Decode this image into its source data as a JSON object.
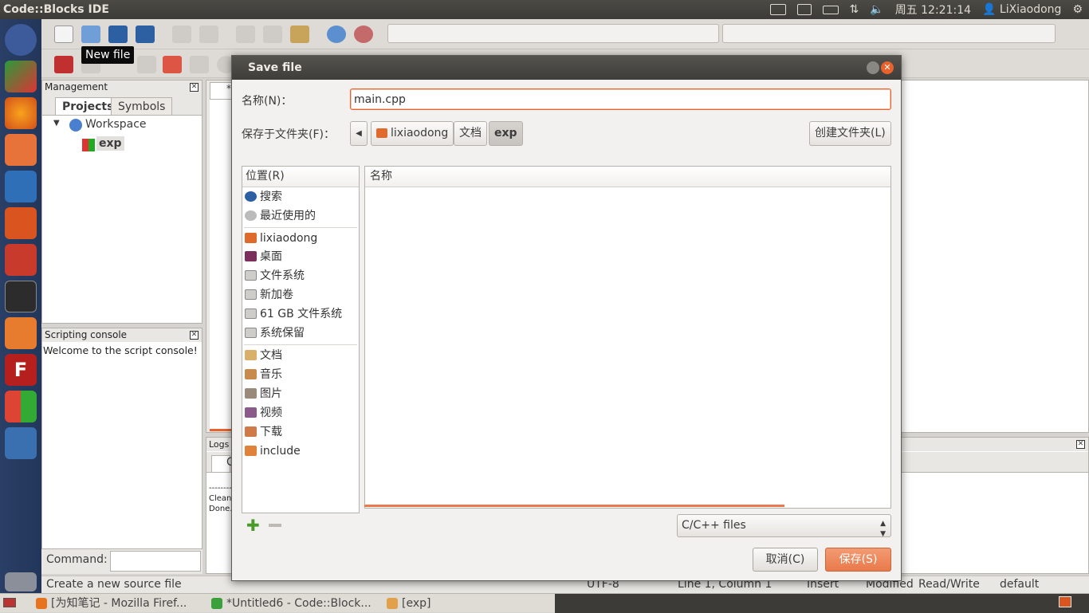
{
  "window": {
    "title": "Code::Blocks IDE"
  },
  "tray": {
    "clock": "周五 12:21:14",
    "user": "LiXiaodong"
  },
  "tooltip": "New file",
  "management": {
    "title": "Management",
    "tabs": [
      "Projects",
      "Symbols"
    ],
    "tree": {
      "root": "Workspace",
      "child": "exp"
    }
  },
  "scripting": {
    "title": "Scripting console",
    "welcome": "Welcome to the script console!",
    "command_label": "Command:"
  },
  "logs": {
    "title": "Logs",
    "tab_partial": "C",
    "lines": [
      "--------",
      "Clean",
      "Done."
    ]
  },
  "dialog": {
    "title": "Save file",
    "name_label": "名称(N)：",
    "name_value": "main.cpp",
    "folder_label": "保存于文件夹(F)：",
    "path": [
      "lixiaodong",
      "文档",
      "exp"
    ],
    "create_folder": "创建文件夹(L)",
    "places_header": "位置(R)",
    "files_header": "名称",
    "places": [
      {
        "label": "搜索",
        "icon": "search-icon"
      },
      {
        "label": "最近使用的",
        "icon": "recent-icon"
      },
      {
        "label": "lixiaodong",
        "icon": "home-folder-icon"
      },
      {
        "label": "桌面",
        "icon": "desktop-icon"
      },
      {
        "label": "文件系统",
        "icon": "drive-icon"
      },
      {
        "label": "新加卷",
        "icon": "drive-icon"
      },
      {
        "label": "61 GB 文件系统",
        "icon": "drive-icon"
      },
      {
        "label": "系统保留",
        "icon": "drive-icon"
      },
      {
        "label": "文档",
        "icon": "documents-folder-icon"
      },
      {
        "label": "音乐",
        "icon": "music-folder-icon"
      },
      {
        "label": "图片",
        "icon": "pictures-folder-icon"
      },
      {
        "label": "视频",
        "icon": "videos-folder-icon"
      },
      {
        "label": "下载",
        "icon": "downloads-folder-icon"
      },
      {
        "label": "include",
        "icon": "folder-icon"
      }
    ],
    "filter": "C/C++ files",
    "cancel": "取消(C)",
    "save": "保存(S)"
  },
  "statusbar": {
    "message": "Create a new source file",
    "encoding": "UTF-8",
    "position": "Line 1, Column 1",
    "mode": "Insert",
    "modified": "Modified",
    "access": "Read/Write",
    "lang": "default"
  },
  "taskbar": [
    {
      "label": "[为知笔记 - Mozilla Firef...",
      "color": "#e8731f"
    },
    {
      "label": "*Untitled6 - Code::Block...",
      "color": "#3aa03a"
    },
    {
      "label": "[exp]",
      "color": "#e2a04b"
    }
  ],
  "colors": {
    "accent": "#e9622b",
    "save_button": "#ee8a5e",
    "launcher": "#26395e"
  }
}
